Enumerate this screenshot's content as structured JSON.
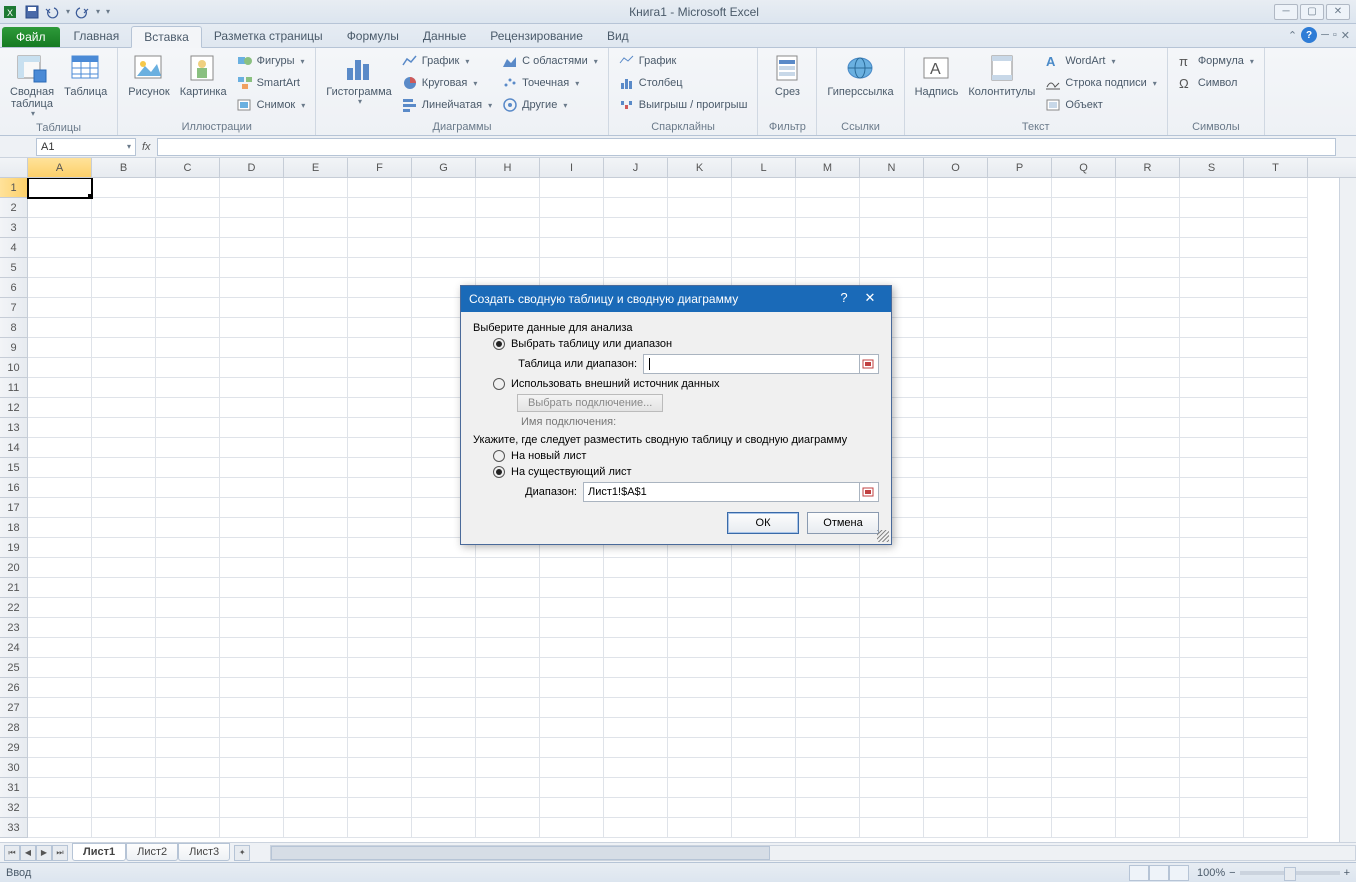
{
  "window": {
    "title": "Книга1  -  Microsoft Excel"
  },
  "tabs": {
    "file": "Файл",
    "items": [
      "Главная",
      "Вставка",
      "Разметка страницы",
      "Формулы",
      "Данные",
      "Рецензирование",
      "Вид"
    ],
    "active": "Вставка"
  },
  "ribbon": {
    "groups": {
      "tables": {
        "label": "Таблицы",
        "pivot": "Сводная\nтаблица",
        "table": "Таблица"
      },
      "illustrations": {
        "label": "Иллюстрации",
        "picture": "Рисунок",
        "clipart": "Картинка",
        "shapes": "Фигуры",
        "smartart": "SmartArt",
        "screenshot": "Снимок"
      },
      "charts": {
        "label": "Диаграммы",
        "column": "Гистограмма",
        "line": "График",
        "pie": "Круговая",
        "bar": "Линейчатая",
        "area": "С областями",
        "scatter": "Точечная",
        "other": "Другие"
      },
      "sparklines": {
        "label": "Спарклайны",
        "line": "График",
        "column": "Столбец",
        "winloss": "Выигрыш / проигрыш"
      },
      "filter": {
        "label": "Фильтр",
        "slicer": "Срез"
      },
      "links": {
        "label": "Ссылки",
        "hyperlink": "Гиперссылка"
      },
      "text": {
        "label": "Текст",
        "textbox": "Надпись",
        "headerfooter": "Колонтитулы",
        "wordart": "WordArt",
        "sigline": "Строка подписи",
        "object": "Объект"
      },
      "symbols": {
        "label": "Символы",
        "equation": "Формула",
        "symbol": "Символ"
      }
    }
  },
  "namebox": "A1",
  "columns": [
    "A",
    "B",
    "C",
    "D",
    "E",
    "F",
    "G",
    "H",
    "I",
    "J",
    "K",
    "L",
    "M",
    "N",
    "O",
    "P",
    "Q",
    "R",
    "S",
    "T"
  ],
  "rows": 33,
  "sheets": {
    "items": [
      "Лист1",
      "Лист2",
      "Лист3"
    ],
    "active": "Лист1"
  },
  "status": {
    "mode": "Ввод",
    "zoom": "100%"
  },
  "dialog": {
    "title": "Создать сводную таблицу и сводную диаграмму",
    "section1": "Выберите данные для анализа",
    "opt_range": "Выбрать таблицу или диапазон",
    "range_label": "Таблица или диапазон:",
    "range_value": "",
    "opt_external": "Использовать внешний источник данных",
    "choose_conn": "Выбрать подключение...",
    "conn_name_label": "Имя подключения:",
    "section2": "Укажите, где следует разместить сводную таблицу и сводную диаграмму",
    "opt_newsheet": "На новый лист",
    "opt_existing": "На существующий лист",
    "loc_label": "Диапазон:",
    "loc_value": "Лист1!$A$1",
    "ok": "ОК",
    "cancel": "Отмена"
  }
}
